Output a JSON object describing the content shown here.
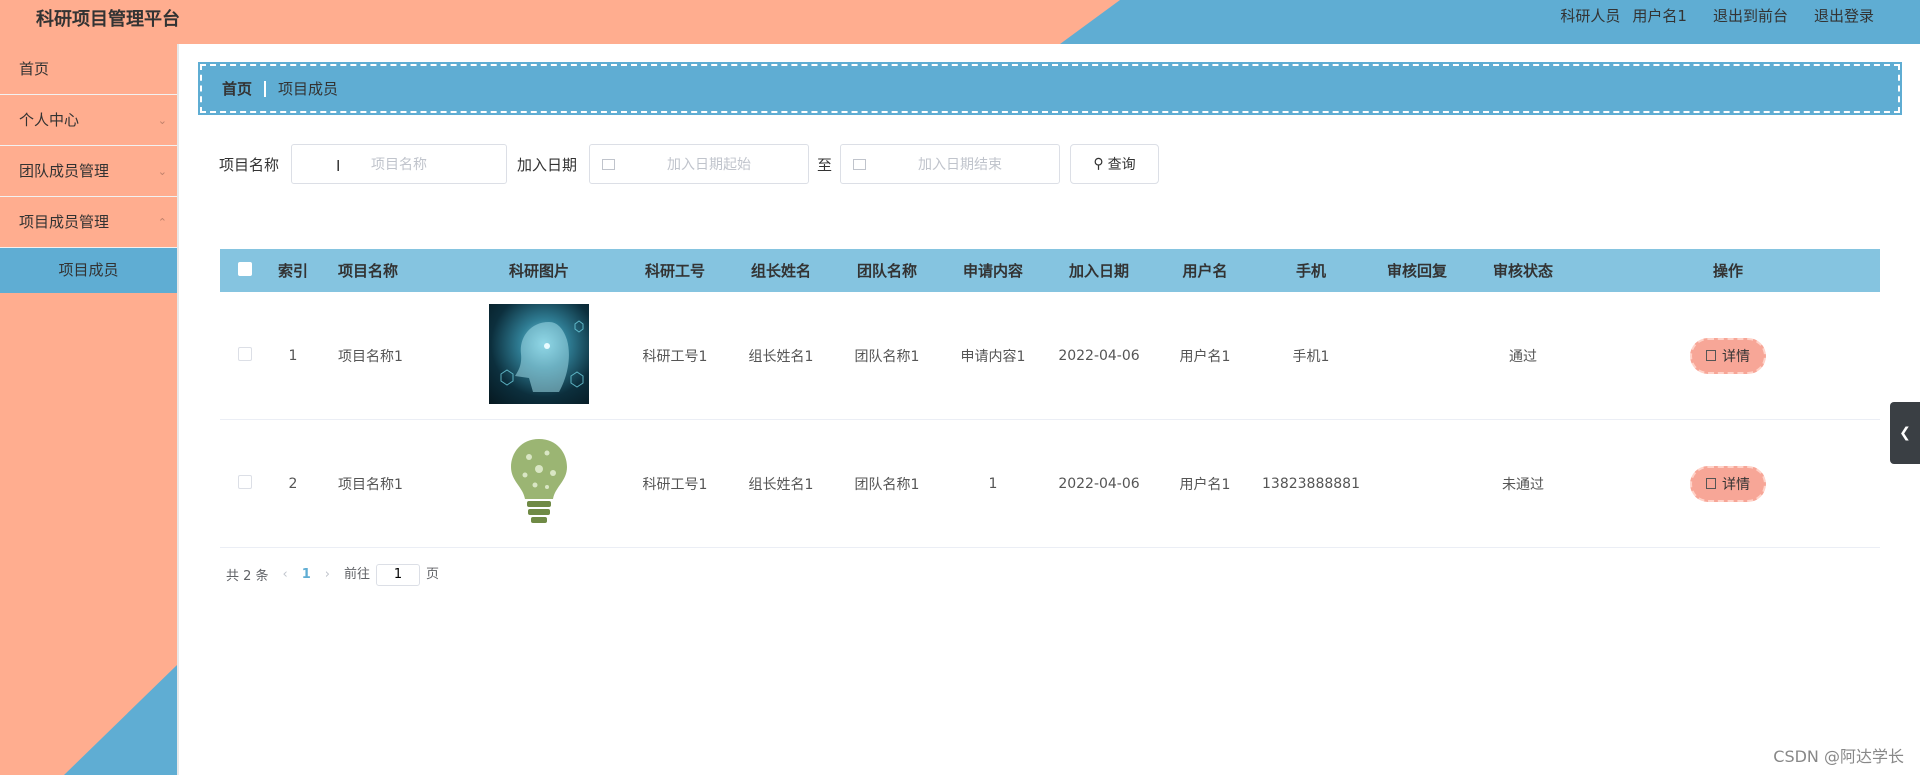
{
  "header": {
    "title": "科研项目管理平台",
    "role": "科研人员",
    "username": "用户名1",
    "exit_front": "退出到前台",
    "logout": "退出登录"
  },
  "sidebar": {
    "items": [
      {
        "label": "首页"
      },
      {
        "label": "个人中心"
      },
      {
        "label": "团队成员管理"
      },
      {
        "label": "项目成员管理"
      }
    ],
    "active_sub": "项目成员"
  },
  "breadcrumb": {
    "home": "首页",
    "current": "项目成员"
  },
  "search": {
    "name_label": "项目名称",
    "name_placeholder": "项目名称",
    "date_label": "加入日期",
    "date_start_placeholder": "加入日期起始",
    "to": "至",
    "date_end_placeholder": "加入日期结束",
    "query_button": "查询"
  },
  "table": {
    "headers": [
      "索引",
      "项目名称",
      "科研图片",
      "科研工号",
      "组长姓名",
      "团队名称",
      "申请内容",
      "加入日期",
      "用户名",
      "手机",
      "审核回复",
      "审核状态",
      "操作"
    ],
    "rows": [
      {
        "index": "1",
        "project": "项目名称1",
        "image": "ai-face-image",
        "staff_id": "科研工号1",
        "leader": "组长姓名1",
        "team": "团队名称1",
        "content": "申请内容1",
        "date": "2022-04-06",
        "user": "用户名1",
        "phone": "手机1",
        "reply": "",
        "status": "通过",
        "action": "详情"
      },
      {
        "index": "2",
        "project": "项目名称1",
        "image": "green-bulb-image",
        "staff_id": "科研工号1",
        "leader": "组长姓名1",
        "team": "团队名称1",
        "content": "1",
        "date": "2022-04-06",
        "user": "用户名1",
        "phone": "13823888881",
        "reply": "",
        "status": "未通过",
        "action": "详情"
      }
    ]
  },
  "pager": {
    "total": "共 2 条",
    "page": "1",
    "goto": "前往",
    "page_input": "1",
    "page_unit": "页"
  },
  "watermark": "CSDN @阿达学长",
  "colors": {
    "salmon": "#ffad8f",
    "blue": "#5fadd3",
    "table_head": "#85c4e0"
  }
}
